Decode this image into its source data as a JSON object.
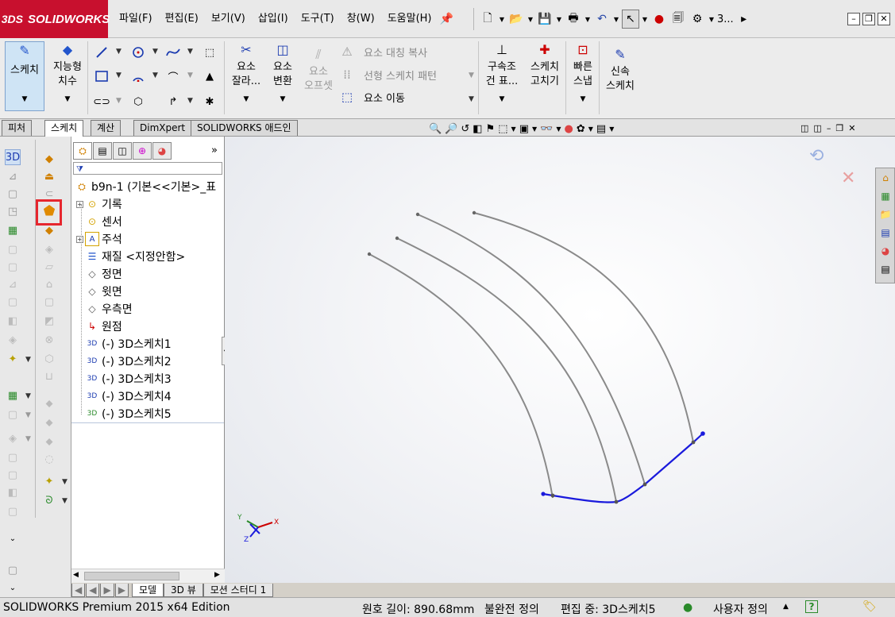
{
  "app": {
    "brand": "SOLIDWORKS",
    "brand_mark": "3DS"
  },
  "menu": [
    "파일(F)",
    "편집(E)",
    "보기(V)",
    "삽입(I)",
    "도구(T)",
    "창(W)",
    "도움말(H)"
  ],
  "quickbar": {
    "truncated": "3..."
  },
  "ribbon": {
    "sketch": "스케치",
    "smart_dim": [
      "지능형",
      "치수"
    ],
    "trim": [
      "요소",
      "잘라..."
    ],
    "convert": [
      "요소",
      "변환"
    ],
    "offset": [
      "요소",
      "오프셋"
    ],
    "mirror": "요소 대칭 복사",
    "linear_pattern": "선형 스케치 패턴",
    "move": "요소 이동",
    "relations": [
      "구속조",
      "건 표..."
    ],
    "repair": [
      "스케치",
      "고치기"
    ],
    "quick_snap": [
      "빠른",
      "스냅"
    ],
    "rapid_sketch": [
      "신속",
      "스케치"
    ]
  },
  "tabs": [
    "피처",
    "스케치",
    "계산",
    "DimXpert",
    "SOLIDWORKS 애드인"
  ],
  "tree": {
    "root": "b9n-1  (기본<<기본>_표",
    "items": [
      "기록",
      "센서",
      "주석",
      "재질 <지정안함>",
      "정면",
      "윗면",
      "우측면",
      "원점",
      "(-) 3D스케치1",
      "(-) 3D스케치2",
      "(-) 3D스케치3",
      "(-) 3D스케치4",
      "(-) 3D스케치5"
    ]
  },
  "bottom_tabs": [
    "모델",
    "3D 뷰",
    "모션 스터디 1"
  ],
  "status": {
    "edition": "SOLIDWORKS Premium 2015 x64 Edition",
    "arc_length": "원호 길이: 890.68mm",
    "definition": "불완전 정의",
    "editing": "편집 중: 3D스케치5",
    "custom": "사용자 정의",
    "help": "?"
  },
  "axes": {
    "x": "X",
    "y": "Y",
    "z": "Z"
  },
  "colors": {
    "brand_red": "#c8102e",
    "sketch_blue": "#1a1adc",
    "curve_gray": "#8a8a8a",
    "highlight": "#e6262e"
  }
}
